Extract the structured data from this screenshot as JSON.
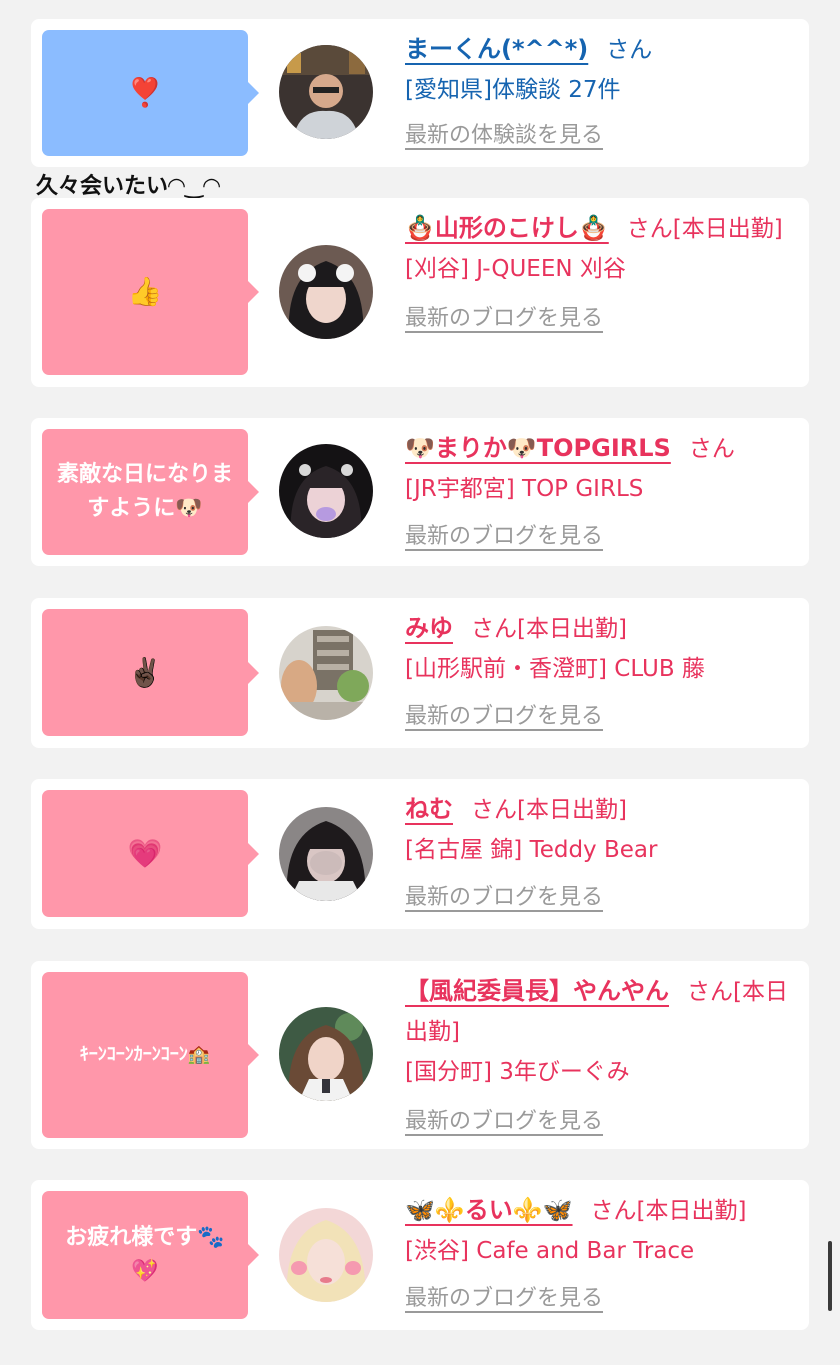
{
  "colors": {
    "background": "#f2f2f2",
    "card": "#ffffff",
    "pink_accent": "#e8335d",
    "pink_bubble": "#ff97aa",
    "blue_bubble": "#8bbcff",
    "blue_accent": "#1664b0",
    "link_gray": "#9a9a9a"
  },
  "entries": [
    {
      "bubble_text": "❣️",
      "bubble_color": "blue",
      "name": "まーくん(*^^*)",
      "suffix": "さん",
      "shop": "[愛知県]体験談 27件",
      "more_link": "最新の体験談を見る"
    },
    {
      "bubble_text": "👍",
      "bubble_color": "pink",
      "name": "🪆山形のこけし🪆",
      "suffix": "さん[本日出勤]",
      "shop": "[刈谷] J-QUEEN 刈谷",
      "more_link": "最新のブログを見る"
    },
    {
      "bubble_text": "素敵な日になりますように🐶",
      "bubble_color": "pink",
      "name": "🐶まりか🐶TOPGIRLS",
      "suffix": "さん",
      "shop": "[JR宇都宮] TOP GIRLS",
      "more_link": "最新のブログを見る"
    },
    {
      "bubble_text": "✌🏿",
      "bubble_color": "pink",
      "name": "みゆ",
      "suffix": "さん[本日出勤]",
      "shop": "[山形駅前・香澄町] CLUB 藤",
      "more_link": "最新のブログを見る"
    },
    {
      "bubble_text": "💗",
      "bubble_color": "pink",
      "name": "ねむ",
      "suffix": "さん[本日出勤]",
      "shop": "[名古屋 錦] Teddy Bear",
      "more_link": "最新のブログを見る"
    },
    {
      "bubble_text": "ｷｰﾝｺｰﾝｶｰﾝｺｰﾝ🏫",
      "bubble_color": "pink",
      "name": "【風紀委員長】やんやん",
      "suffix": "さん[本日出勤]",
      "shop": "[国分町] 3年びーぐみ",
      "more_link": "最新のブログを見る"
    },
    {
      "bubble_text": "お疲れ様です🐾💖",
      "bubble_color": "pink",
      "name": "🦋⚜️るい⚜️🦋",
      "suffix": "さん[本日出勤]",
      "shop": "[渋谷] Cafe and Bar Trace",
      "more_link": "最新のブログを見る"
    }
  ],
  "note": "久々会いたい◠‿◠"
}
